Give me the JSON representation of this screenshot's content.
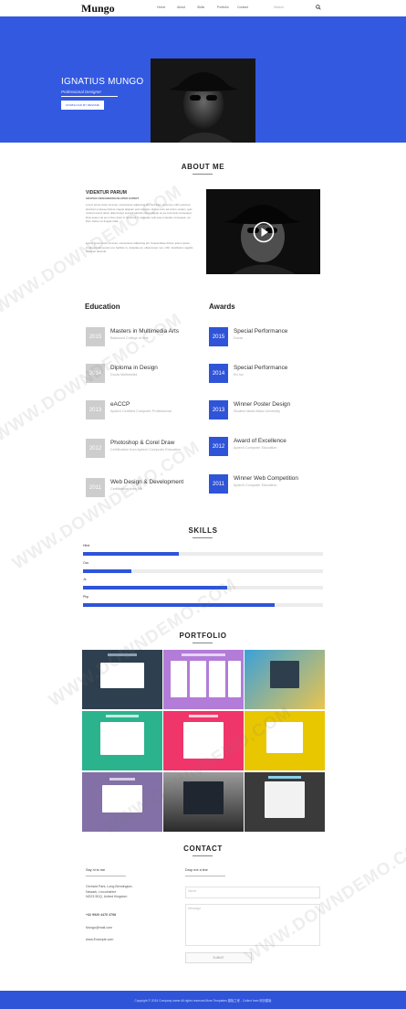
{
  "nav": {
    "logo": "Mungo",
    "links": [
      "Home",
      "About",
      "Skills",
      "Portfolio",
      "Contact"
    ],
    "search_placeholder": "Search"
  },
  "hero": {
    "name": "IGNATIUS MUNGO",
    "subtitle": "Professional Designer",
    "button": "DOWNLOAD MY RESUME",
    "bg_color": "#3359e0"
  },
  "about": {
    "title": "ABOUT ME",
    "name": "VIDENTUR PARUM",
    "role": "GRAPHIC DESIGNER/DEVELOPER EXPERT",
    "paragraph1": "Lorem ipsum dolor sit amet, consectetur adipiscing elit, sed diam nonummy nibh euismod tincidunt ut laoreet dolore magna aliquam erat volutpat. Ut wisi enim ad minim veniam, quis nostrud exerci tation ullamcorper suscipit lobortis nisl ut aliquip ex ea commodo consequat. Duis autem vel eum iriure dolor in hendrerit in vulputate velit esse molestie consequat, vel illum dolore eu feugiat nulla.",
    "paragraph2": "Lorem ipsum dolor sit amet, consectetur adipiscing elit. Suspendisse dictum ipsum ipsum. In aliquet elementum est, facilisis in, vulputate ac, ullamcorper nec, nibh. Vestibulum sagittis lorem ac placerat."
  },
  "education": {
    "title": "Education",
    "items": [
      {
        "year": "2015",
        "title": "Masters in Multimedia Arts",
        "sub": "Balanced College of Arts"
      },
      {
        "year": "2014",
        "title": "Diploma in Design",
        "sub": "Ducta Multimedia"
      },
      {
        "year": "2013",
        "title": "eACCP",
        "sub": "Aptech Certified Computer Professional"
      },
      {
        "year": "2012",
        "title": "Photoshop & Corel Draw",
        "sub": "Certification from Aptech Computer Education"
      },
      {
        "year": "2011",
        "title": "Web Design & Development",
        "sub": "Certification from Niit"
      }
    ]
  },
  "awards": {
    "title": "Awards",
    "items": [
      {
        "year": "2015",
        "title": "Special Performance",
        "sub": "Ducta"
      },
      {
        "year": "2014",
        "title": "Special Performance",
        "sub": "Ed Inc"
      },
      {
        "year": "2013",
        "title": "Winner Poster Design",
        "sub": "Studest Ideas Mass University"
      },
      {
        "year": "2012",
        "title": "Award of Excellence",
        "sub": "Aptech Computer Education"
      },
      {
        "year": "2011",
        "title": "Winner Web Competition",
        "sub": "Aptech Computer Education"
      }
    ]
  },
  "skills": {
    "title": "SKILLS",
    "items": [
      {
        "name": "Html",
        "level": 0.4
      },
      {
        "name": "Css",
        "level": 0.2
      },
      {
        "name": "Js",
        "level": 0.6
      },
      {
        "name": "Php",
        "level": 0.8
      }
    ],
    "fill_color": "#2f54d8"
  },
  "portfolio": {
    "title": "PORTFOLIO",
    "tiles": [
      {
        "bg": "#2e3f4f"
      },
      {
        "bg": "#b37cd8"
      },
      {
        "bg": "#e9c44f"
      },
      {
        "bg": "#2bb38e"
      },
      {
        "bg": "#f0356a"
      },
      {
        "bg": "#e8c600"
      },
      {
        "bg": "#8270a6"
      },
      {
        "bg": "#555555"
      },
      {
        "bg": "#3a3a3a"
      }
    ]
  },
  "contact": {
    "title": "CONTACT",
    "left_label": "Say hi to me",
    "address": [
      "Orchard Park, Long Bennington,",
      "Newark, Lincolnshire",
      "NG23 5DQ, United Kingdom"
    ],
    "phone": "+32 9920 4470 4798",
    "email": "Mungo@mail.com",
    "website": "www.Example.com",
    "right_label": "Drop me a line",
    "name_placeholder": "Name",
    "message_placeholder": "Message",
    "send": "SUBMIT"
  },
  "footer": {
    "text": "Copyright © 2015 Company name All rights reserved.More Templates 模板之家 - Collect from 网页模板"
  },
  "watermark": "WWW.DOWNDEMO.COM"
}
